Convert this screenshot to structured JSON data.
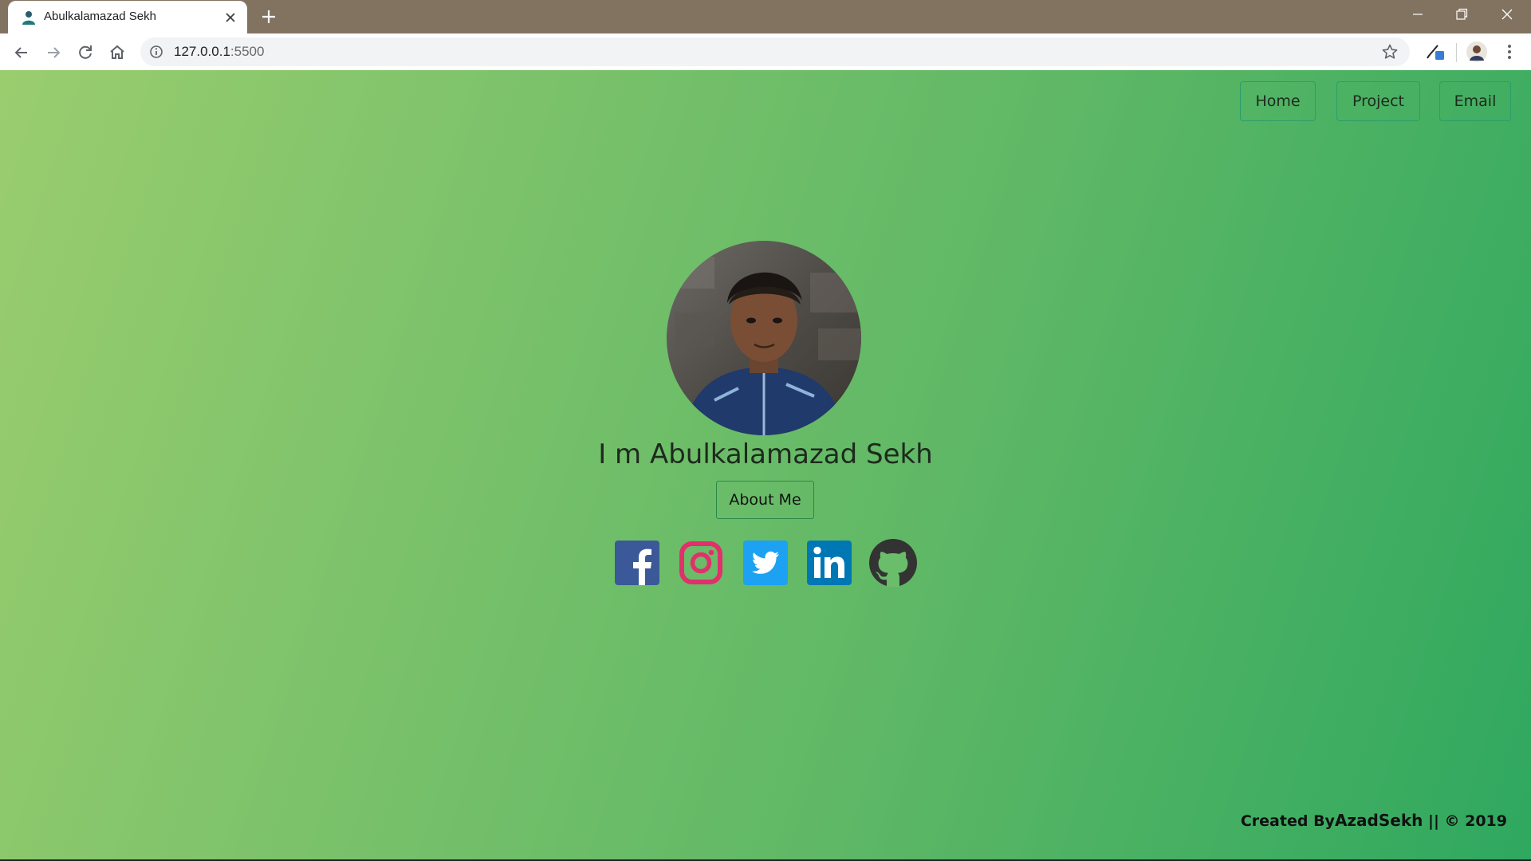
{
  "browser": {
    "tab": {
      "title": "Abulkalamazad Sekh"
    },
    "address": {
      "url_host": "127.0.0.1",
      "url_port": ":5500"
    }
  },
  "nav": {
    "items": [
      {
        "label": "Home"
      },
      {
        "label": "Project"
      },
      {
        "label": "Email"
      }
    ]
  },
  "hero": {
    "heading": "I m Abulkalamazad Sekh",
    "about_button": "About Me",
    "socials": [
      {
        "name": "facebook-icon",
        "color": "#3b5998"
      },
      {
        "name": "instagram-icon",
        "color": "#e1306c"
      },
      {
        "name": "twitter-icon",
        "color": "#1da1f2"
      },
      {
        "name": "linkedin-icon",
        "color": "#0077b5"
      },
      {
        "name": "github-icon",
        "color": "#333333"
      }
    ]
  },
  "footer": {
    "created_by": "Created By",
    "author": "AzadSekh",
    "suffix": " || © 2019"
  },
  "colors": {
    "chrome_titlebar": "#827361",
    "nav_border": "#2a9e6a",
    "gradient_start": "#9acd6e",
    "gradient_end": "#2fa85f"
  }
}
